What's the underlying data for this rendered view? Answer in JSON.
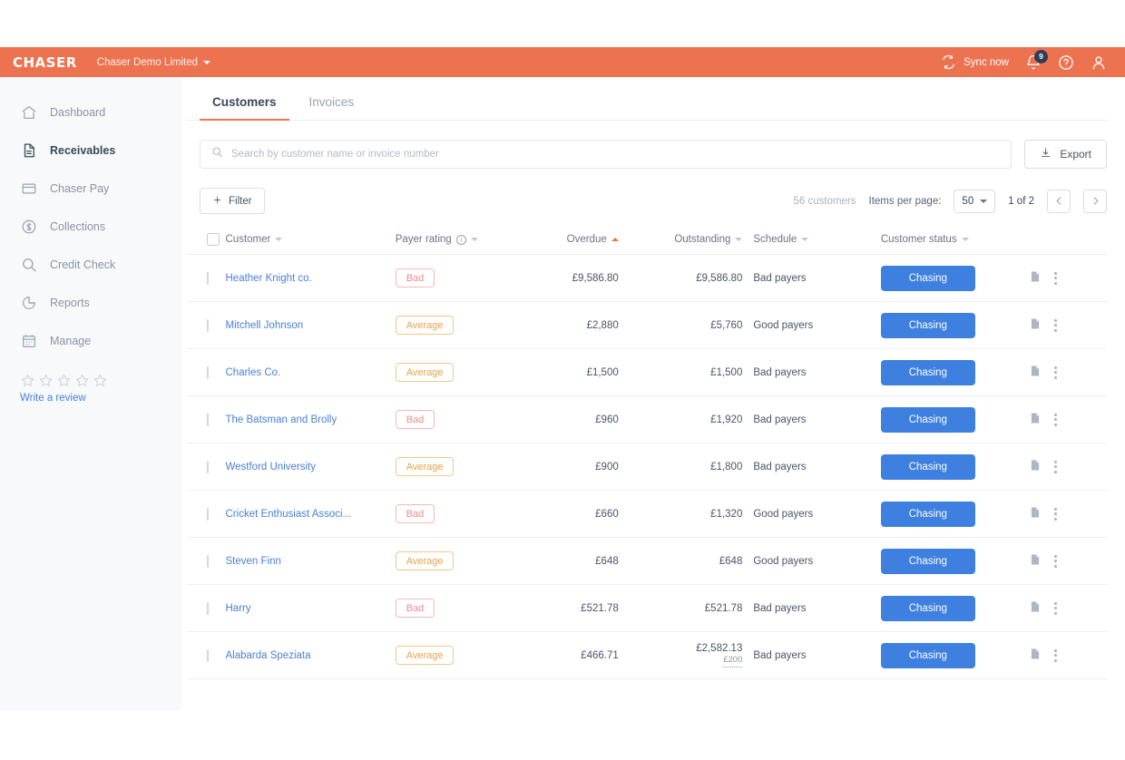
{
  "topbar": {
    "logo": "CHASER",
    "org": "Chaser Demo Limited",
    "sync_label": "Sync now",
    "notification_count": "9",
    "icons": [
      "sync-icon",
      "bell-icon",
      "help-icon",
      "user-icon"
    ]
  },
  "sidebar": {
    "items": [
      {
        "label": "Dashboard",
        "icon": "home-icon",
        "active": false
      },
      {
        "label": "Receivables",
        "icon": "document-icon",
        "active": true
      },
      {
        "label": "Chaser Pay",
        "icon": "card-icon",
        "active": false
      },
      {
        "label": "Collections",
        "icon": "dollar-circle-icon",
        "active": false
      },
      {
        "label": "Credit Check",
        "icon": "search-icon",
        "active": false
      },
      {
        "label": "Reports",
        "icon": "pie-chart-icon",
        "active": false
      },
      {
        "label": "Manage",
        "icon": "calendar-icon",
        "active": false
      }
    ],
    "review": {
      "stars": 5,
      "link_label": "Write a review"
    }
  },
  "tabs": [
    {
      "label": "Customers",
      "active": true
    },
    {
      "label": "Invoices",
      "active": false
    }
  ],
  "search": {
    "placeholder": "Search by customer name or invoice number",
    "value": ""
  },
  "export": {
    "label": "Export",
    "icon": "download-icon"
  },
  "toolbar": {
    "filter_label": "Filter",
    "customer_count": "56 customers",
    "items_per_page_label": "Items per page:",
    "items_per_page_value": "50",
    "page_indicator": "1 of 2",
    "prev_icon": "chevron-left-icon",
    "next_icon": "chevron-right-icon"
  },
  "table": {
    "columns": [
      {
        "label": "Customer",
        "sort": "none",
        "align": "left"
      },
      {
        "label": "Payer rating",
        "sort": "none",
        "align": "left",
        "info": true
      },
      {
        "label": "Overdue",
        "sort": "asc",
        "align": "right"
      },
      {
        "label": "Outstanding",
        "sort": "none",
        "align": "right"
      },
      {
        "label": "Schedule",
        "sort": "none",
        "align": "left"
      },
      {
        "label": "Customer status",
        "sort": "none",
        "align": "left"
      }
    ],
    "rows": [
      {
        "customer": "Heather Knight co.",
        "rating": "Bad",
        "rating_kind": "bad",
        "overdue": "£9,586.80",
        "outstanding": "£9,586.80",
        "outstanding_sub": "",
        "schedule": "Bad payers",
        "status": "Chasing"
      },
      {
        "customer": "Mitchell Johnson",
        "rating": "Average",
        "rating_kind": "average",
        "overdue": "£2,880",
        "outstanding": "£5,760",
        "outstanding_sub": "",
        "schedule": "Good payers",
        "status": "Chasing"
      },
      {
        "customer": "Charles Co.",
        "rating": "Average",
        "rating_kind": "average",
        "overdue": "£1,500",
        "outstanding": "£1,500",
        "outstanding_sub": "",
        "schedule": "Bad payers",
        "status": "Chasing"
      },
      {
        "customer": "The Batsman and Brolly",
        "rating": "Bad",
        "rating_kind": "bad",
        "overdue": "£960",
        "outstanding": "£1,920",
        "outstanding_sub": "",
        "schedule": "Bad payers",
        "status": "Chasing"
      },
      {
        "customer": "Westford University",
        "rating": "Average",
        "rating_kind": "average",
        "overdue": "£900",
        "outstanding": "£1,800",
        "outstanding_sub": "",
        "schedule": "Bad payers",
        "status": "Chasing"
      },
      {
        "customer": "Cricket Enthusiast Associ...",
        "rating": "Bad",
        "rating_kind": "bad",
        "overdue": "£660",
        "outstanding": "£1,320",
        "outstanding_sub": "",
        "schedule": "Good payers",
        "status": "Chasing"
      },
      {
        "customer": "Steven Finn",
        "rating": "Average",
        "rating_kind": "average",
        "overdue": "£648",
        "outstanding": "£648",
        "outstanding_sub": "",
        "schedule": "Good payers",
        "status": "Chasing"
      },
      {
        "customer": "Harry",
        "rating": "Bad",
        "rating_kind": "bad",
        "overdue": "£521.78",
        "outstanding": "£521.78",
        "outstanding_sub": "",
        "schedule": "Bad payers",
        "status": "Chasing"
      },
      {
        "customer": "Alabarda Speziata",
        "rating": "Average",
        "rating_kind": "average",
        "overdue": "£466.71",
        "outstanding": "£2,582.13",
        "outstanding_sub": "£200",
        "schedule": "Bad payers",
        "status": "Chasing"
      }
    ],
    "row_icons": [
      "note-icon",
      "more-vertical-icon"
    ]
  },
  "colors": {
    "brand_orange": "#ED7350",
    "action_blue": "#3E80E0",
    "link_blue": "#4A7FD6",
    "bad_red": "#F08A8A",
    "average_amber": "#E3A34B",
    "sidebar_bg": "#F7F9FB"
  }
}
